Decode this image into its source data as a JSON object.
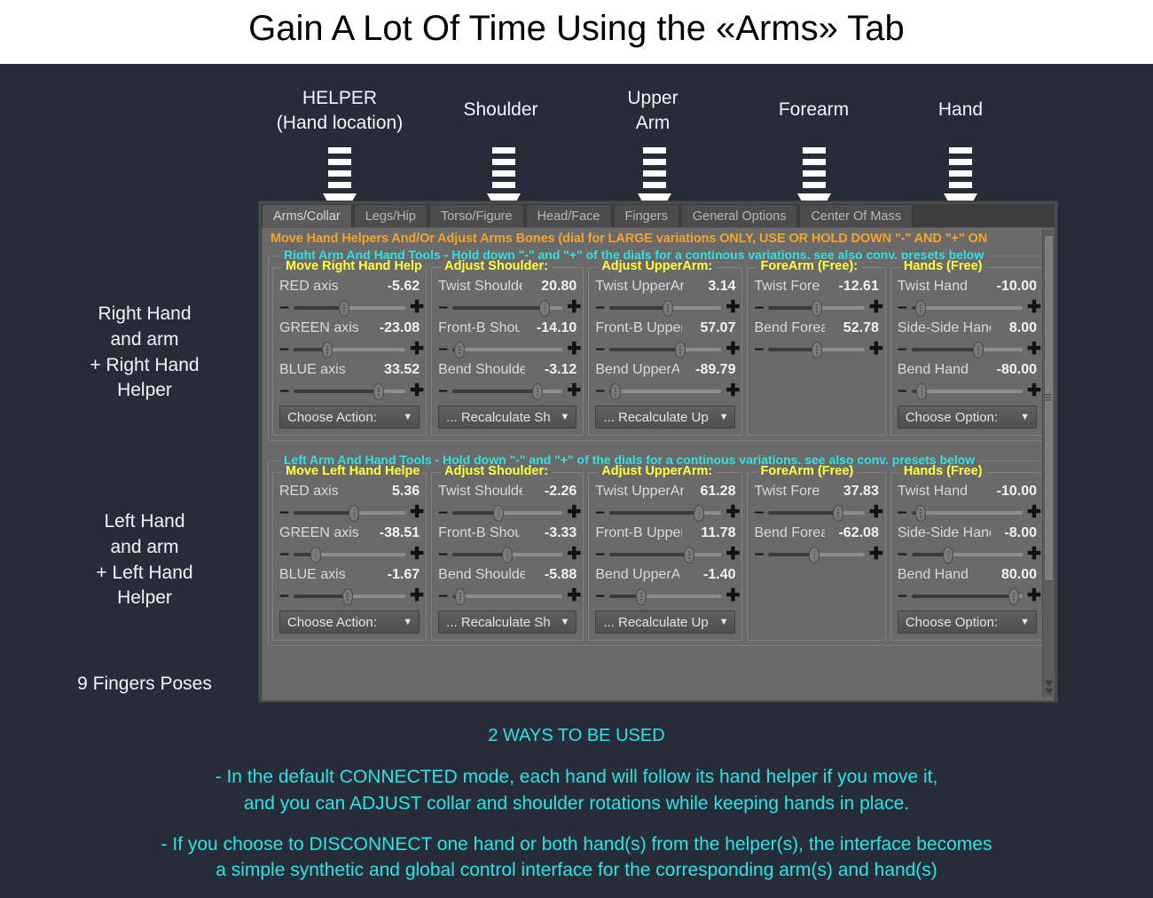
{
  "slide": {
    "title": "Gain A Lot Of Time Using the «Arms» Tab",
    "background_color": "#262d38",
    "accent_cyan": "#2de3e3",
    "accent_yellow": "#ffff3b",
    "accent_orange": "#f0a52a"
  },
  "callouts": [
    {
      "line1": "HELPER",
      "line2": "(Hand location)"
    },
    {
      "line1": "Shoulder",
      "line2": ""
    },
    {
      "line1": "Upper",
      "line2": "Arm"
    },
    {
      "line1": "Forearm",
      "line2": ""
    },
    {
      "line1": "Hand",
      "line2": ""
    }
  ],
  "left_notes": [
    {
      "text": "Right Hand\nand arm\n+ Right Hand\nHelper"
    },
    {
      "text": "Left Hand\nand arm\n+ Left Hand\nHelper"
    },
    {
      "text": "9 Fingers Poses"
    }
  ],
  "plugin": {
    "tabs": [
      {
        "label": "Arms/Collar",
        "active": true
      },
      {
        "label": "Legs/Hip",
        "active": false
      },
      {
        "label": "Torso/Figure",
        "active": false
      },
      {
        "label": "Head/Face",
        "active": false
      },
      {
        "label": "Fingers",
        "active": false
      },
      {
        "label": "General Options",
        "active": false
      },
      {
        "label": "Center Of Mass",
        "active": false
      }
    ],
    "header_note": "Move Hand Helpers And/Or Adjust Arms Bones (dial for LARGE variations ONLY, USE OR HOLD DOWN \"-\" AND \"+\" ON",
    "minus_glyph": "–",
    "plus_glyph": "✚",
    "caret_glyph": "▼",
    "sections": [
      {
        "legend": "Right Arm And Hand Tools - Hold down \"-\" and \"+\" of the dials for a continous variations, see also conv. presets below",
        "panels": [
          {
            "legend": "Move Right Hand Help",
            "dials": [
              {
                "label": "RED axis",
                "value": "-5.62",
                "pos": 45
              },
              {
                "label": "GREEN axis",
                "value": "-23.08",
                "pos": 30
              },
              {
                "label": "BLUE axis",
                "value": "33.52",
                "pos": 76
              }
            ],
            "dropdown": "Choose Action:"
          },
          {
            "legend": "Adjust Shoulder:",
            "dials": [
              {
                "label": "Twist Shoulder",
                "value": "20.80",
                "pos": 84
              },
              {
                "label": "Front-B Shoulder",
                "value": "-14.10",
                "pos": 6
              },
              {
                "label": "Bend Shoulder",
                "value": "-3.12",
                "pos": 77
              }
            ],
            "dropdown": "... Recalculate Sh"
          },
          {
            "legend": "Adjust UpperArm:",
            "dials": [
              {
                "label": "Twist UpperArm",
                "value": "3.14",
                "pos": 52
              },
              {
                "label": "Front-B UpperArm",
                "value": "57.07",
                "pos": 63
              },
              {
                "label": "Bend UpperArm",
                "value": "-89.79",
                "pos": 5
              }
            ],
            "dropdown": "... Recalculate Up"
          },
          {
            "legend": "ForeArm (Free):",
            "dials": [
              {
                "label": "Twist Fore",
                "value": "-12.61",
                "pos": 50
              },
              {
                "label": "Bend Forearm",
                "value": "52.78",
                "pos": 50
              }
            ],
            "dropdown": ""
          },
          {
            "legend": "Hands (Free)",
            "dials": [
              {
                "label": "Twist Hand",
                "value": "-10.00",
                "pos": 8
              },
              {
                "label": "Side-Side Hand",
                "value": "8.00",
                "pos": 60
              },
              {
                "label": "Bend Hand",
                "value": "-80.00",
                "pos": 9
              }
            ],
            "dropdown": "Choose Option:"
          }
        ]
      },
      {
        "legend": "Left Arm And Hand Tools - Hold down \"-\" and \"+\" of the dials for a continous variations, see also conv. presets below",
        "panels": [
          {
            "legend": "Move Left Hand Helpe",
            "dials": [
              {
                "label": "RED axis",
                "value": "5.36",
                "pos": 54
              },
              {
                "label": "GREEN axis",
                "value": "-38.51",
                "pos": 20
              },
              {
                "label": "BLUE axis",
                "value": "-1.67",
                "pos": 48
              }
            ],
            "dropdown": "Choose Action:"
          },
          {
            "legend": "Adjust Shoulder:",
            "dials": [
              {
                "label": "Twist Shoulder",
                "value": "-2.26",
                "pos": 42
              },
              {
                "label": "Front-B Shoulder",
                "value": "-3.33",
                "pos": 50
              },
              {
                "label": "Bend Shoulder",
                "value": "-5.88",
                "pos": 7
              }
            ],
            "dropdown": "... Recalculate Sh"
          },
          {
            "legend": "Adjust UpperArm:",
            "dials": [
              {
                "label": "Twist UpperArm",
                "value": "61.28",
                "pos": 80
              },
              {
                "label": "Front-B UpperArm",
                "value": "11.78",
                "pos": 71
              },
              {
                "label": "Bend UpperArm",
                "value": "-1.40",
                "pos": 28
              }
            ],
            "dropdown": "... Recalculate Up"
          },
          {
            "legend": "ForeArm (Free)",
            "dials": [
              {
                "label": "Twist Fore",
                "value": "37.83",
                "pos": 72
              },
              {
                "label": "Bend Forearm",
                "value": "-62.08",
                "pos": 48
              }
            ],
            "dropdown": ""
          },
          {
            "legend": "Hands (Free)",
            "dials": [
              {
                "label": "Twist Hand",
                "value": "-10.00",
                "pos": 8
              },
              {
                "label": "Side-Side Hand",
                "value": "-8.00",
                "pos": 33
              },
              {
                "label": "Bend Hand",
                "value": "80.00",
                "pos": 92
              }
            ],
            "dropdown": "Choose Option:"
          }
        ]
      }
    ]
  },
  "bottom": {
    "heading": "2 WAYS TO BE USED",
    "paragraph1_line1": "- In the default CONNECTED mode, each hand will follow its hand helper if you move it,",
    "paragraph1_line2": "and you can ADJUST collar and shoulder rotations while keeping hands in place.",
    "paragraph2_line1": "- If you choose to DISCONNECT one hand or both hand(s) from the helper(s), the interface becomes",
    "paragraph2_line2": "a simple synthetic and global control interface for the corresponding arm(s) and hand(s)"
  }
}
